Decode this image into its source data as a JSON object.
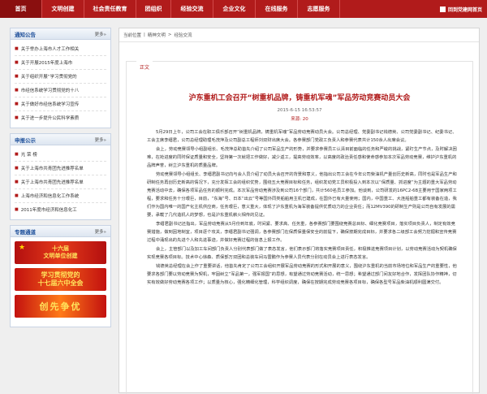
{
  "nav": {
    "items": [
      "首页",
      "文明创建",
      "社会责任教育",
      "团组织",
      "经验交流",
      "企业文化",
      "在线服务",
      "志愿服务"
    ],
    "right_label": "回到党建网首页"
  },
  "sidebar": {
    "notice": {
      "title": "通知公告",
      "more": "更多»",
      "items": [
        "关于举办上海市人才工作相关",
        "关于开展2015年度上海市",
        "关于组织开展“学习贯彻党的",
        "市经信系统学习贯彻党的十八",
        "关于做好市经信系统学习宣传",
        "关于进一步提升公民科学素质"
      ]
    },
    "publicity": {
      "title": "申报公示",
      "more": "更多»",
      "items": [
        "光 荣 榜",
        "关于上海市共青团先进推荐名单",
        "关于上海市共青团先进推荐名单",
        "上海市经济和信息化工作系统",
        "2011年度市经济和信息化工"
      ]
    },
    "special": {
      "title": "专题通道",
      "more": "更多»",
      "banner1_line1": "十六届",
      "banner1_line2": "文明单位创建",
      "banner2_line1": "学习贯彻党的",
      "banner2_line2": "十七届六中全会",
      "banner3": "创先争优"
    }
  },
  "breadcrumb": [
    "当前位置",
    "|",
    "精神文明",
    ">",
    "经验交流"
  ],
  "article": {
    "section_tag": "正文",
    "title": "沪东重机工会召开“树重机品牌，铸重机军魂”军品劳动竞赛动员大会",
    "date": "2015-6-15 16:53:57",
    "source": "来源: 20",
    "paragraphs": [
      "5月29日上午，公司工会在职工俱乐部召开“树重机品牌，铸重机军魂”军品劳动竞赛动员大会。公司总经理、党委副书记钱德英、公司党委副书记、纪委书记、工会主席李缙君，公司总经理助理毛茂萍及公司副总工程师刘双财出席大会。各参赛部门党政工负责人和参赛代表共计150余人出席会议。",
      "会上，劳动竞赛领导小组副组长、毛茂萍总助首先介绍了公司军品生产的形势，并要求参赛员工认清目前面临的任务和严峻的挑战，紧盯生产节点，及时解决困难，在抢进度的同时保证质量和安全，坚持第一次就把工作做好，减少返工，提高劳动效率，以高度的政治责任感和使命感参加本次军品劳动竞赛，维护沪东重机的品牌声誉，树立沪东重机的质量品牌。",
      "劳动竞赛领导小组组长、李缙君副书记向与会人员介绍了动员大会召开的背景和意义，他指出公司工会在今年公司柴油机产量创历史新高，同时也是军品生产和研制任务再创历史新高的情况下，充分发挥工会的组织优势，围绕五大竞赛目标和任务，组织发动党工员积极投入到本次以“保质量、抓进度”为主题的重大军品劳动竞赛活动中去，确保各项军品任务的顺利完成。本次军品劳动竞赛涉及到公司16个部门，共计560名员工参加。他谈到，公司研发的16PC2-6B主要用于国家两项工程，要求和任务十分艰巨，目前，“东海”号、日本“出云”号等国外同类船舶用主机已建成，在国外已有大量使用；国内，中国重工、大连船舶重工都有装备在造，我们作为国内唯一的国产化主机供应商，任务艰巨，意义重大，体现了沪东重机为海军装备提供优质动力的企业责任；而12MV390的研制生产则是公司自有发展的需要，承载了几代造机人的梦想，也是沪东重机薪火相传的见证。",
      "李缙君副书记还指出，军品劳动竞赛从5月份到年底，时间紧、要求高、任务重，各参赛部门要围绕竞赛总目标、细化竞赛项目，落实项目负责人，制定有效竞赛措施，做到因地制宜，项目逐个攻关，李缙君副书记强调，各参赛部门在保质保量保安全的前提下，确保按期完成目标，并要求各二级部工会努力挖掘和宣传竞赛过程中涌现出的先进个人和先进事迹，并做好竞赛过程的信息上报工作。",
      "会上，主管部门以及加工车间部门负责人分别代表部门做了表态发言，他们表示部门将落实竞赛项目责任，积极推进竞赛项目计划，以劳动竞赛活动为契机确保实现竞赛各项目标。技术中心徐森、质保部万双团和总装车间马雷鹏作为参赛人员代表分别在动员会上进行表态发言。",
      "钱德英总经理在会上作了重要讲话，他首先肯定了公司工会组织开展军品劳动竞赛的形式和开展的意义，围绕沪东重机的当前市场地位和军品生产的重要性，他要求各部门要以劳动竞赛为契机，牢固树立“军品第一，强军报国”的思想，有望通过劳动竞赛活动，统一思想；希望通过部门间友好地合作，发挥团队协作精神，切实有效做好劳动竞赛各项工作；以质量为核心，强化精细化管理，科学组织调度，确保在按期完成劳动竞赛各项目标，确保各型号军品柴油机顺利圆满交付。"
    ]
  }
}
